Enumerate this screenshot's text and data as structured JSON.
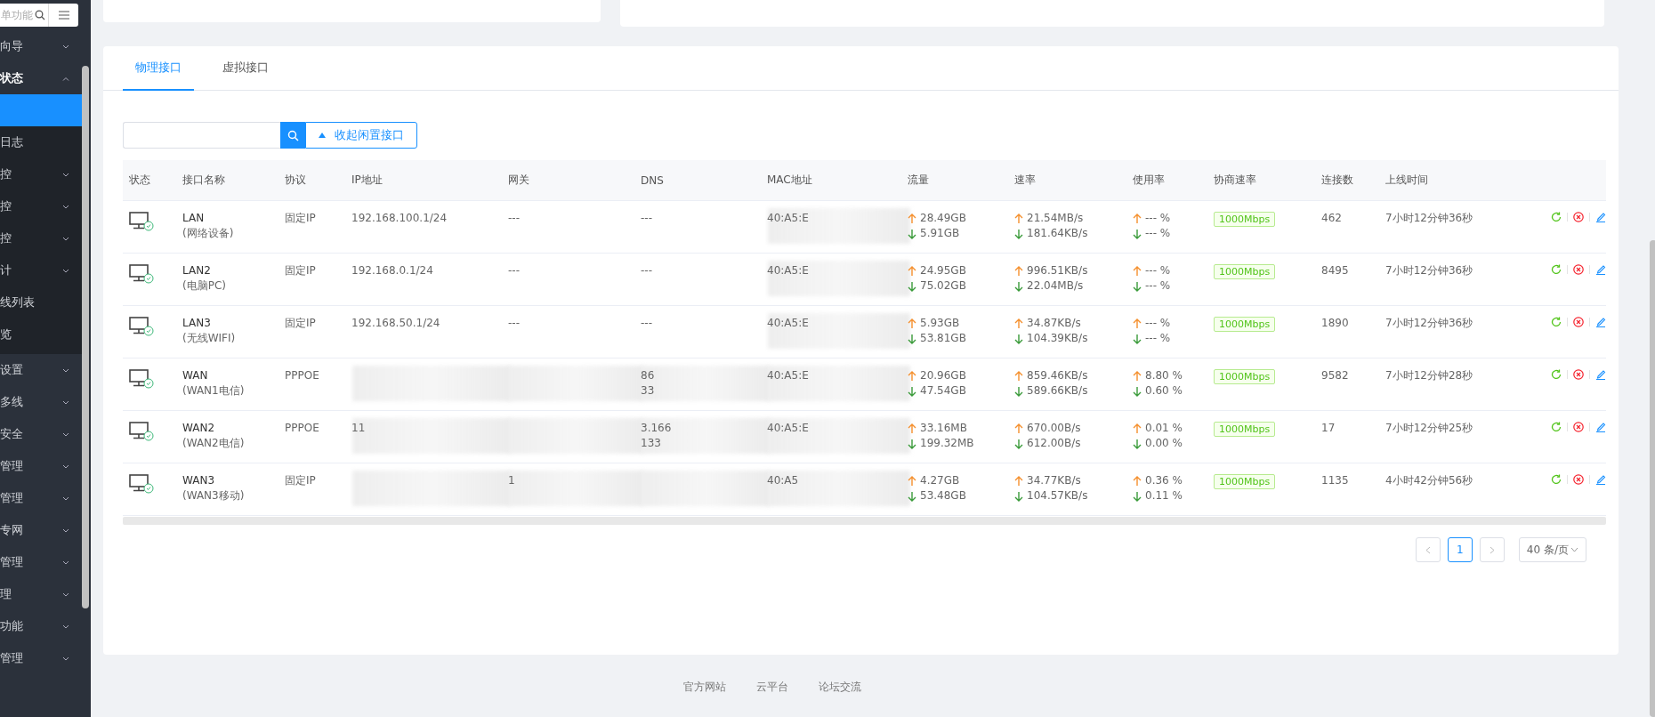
{
  "sidebar": {
    "search_placeholder": "单功能",
    "items": [
      {
        "label": "向导",
        "kind": "group",
        "expanded": false
      },
      {
        "label": "状态",
        "kind": "group",
        "expanded": true,
        "children": [
          {
            "kind": "link",
            "selected": true
          },
          {
            "label": "日志",
            "kind": "link",
            "selected": false
          },
          {
            "label": "控",
            "kind": "group",
            "expanded": false
          },
          {
            "label": "控",
            "kind": "group",
            "expanded": false
          },
          {
            "label": "控",
            "kind": "group",
            "expanded": false
          },
          {
            "label": "计",
            "kind": "group",
            "expanded": false
          },
          {
            "label": "线列表",
            "kind": "link",
            "selected": false
          },
          {
            "label": "览",
            "kind": "link",
            "selected": false
          }
        ]
      },
      {
        "label": "设置",
        "kind": "group",
        "expanded": false
      },
      {
        "label": "多线",
        "kind": "group",
        "expanded": false
      },
      {
        "label": "安全",
        "kind": "group",
        "expanded": false
      },
      {
        "label": "管理",
        "kind": "group",
        "expanded": false
      },
      {
        "label": "管理",
        "kind": "group",
        "expanded": false
      },
      {
        "label": "专网",
        "kind": "group",
        "expanded": false
      },
      {
        "label": "管理",
        "kind": "group",
        "expanded": false
      },
      {
        "label": "理",
        "kind": "group",
        "expanded": false
      },
      {
        "label": "功能",
        "kind": "group",
        "expanded": false
      },
      {
        "label": "管理",
        "kind": "group",
        "expanded": false
      }
    ]
  },
  "tabs": [
    {
      "label": "物理接口",
      "selected": true
    },
    {
      "label": "虚拟接口",
      "selected": false
    }
  ],
  "toolbar": {
    "collapse_button": "收起闲置接口"
  },
  "table": {
    "columns": [
      "状态",
      "接口名称",
      "协议",
      "IP地址",
      "网关",
      "DNS",
      "MAC地址",
      "流量",
      "速率",
      "使用率",
      "协商速率",
      "连接数",
      "上线时间"
    ],
    "rows": [
      {
        "online": true,
        "name": "LAN",
        "note": "(网络设备)",
        "protocol": "固定IP",
        "ip": "192.168.100.1/24",
        "gateway": "---",
        "dns": [
          "---"
        ],
        "mac": "40:A5:E",
        "blur_mac": true,
        "blur_addresses": false,
        "traffic": [
          "28.49GB",
          "5.91GB"
        ],
        "rate": [
          "21.54MB/s",
          "181.64KB/s"
        ],
        "usage": [
          "--- %",
          "--- %"
        ],
        "negotiated": "1000Mbps",
        "connections": "462",
        "uptime": "7小时12分钟36秒"
      },
      {
        "online": true,
        "name": "LAN2",
        "note": "(电脑PC)",
        "protocol": "固定IP",
        "ip": "192.168.0.1/24",
        "gateway": "---",
        "dns": [
          "---"
        ],
        "mac": "40:A5:E",
        "blur_mac": true,
        "blur_addresses": false,
        "traffic": [
          "24.95GB",
          "75.02GB"
        ],
        "rate": [
          "996.51KB/s",
          "22.04MB/s"
        ],
        "usage": [
          "--- %",
          "--- %"
        ],
        "negotiated": "1000Mbps",
        "connections": "8495",
        "uptime": "7小时12分钟36秒"
      },
      {
        "online": true,
        "name": "LAN3",
        "note": "(无线WIFI)",
        "protocol": "固定IP",
        "ip": "192.168.50.1/24",
        "gateway": "---",
        "dns": [
          "---"
        ],
        "mac": "40:A5:E",
        "blur_mac": true,
        "blur_addresses": false,
        "traffic": [
          "5.93GB",
          "53.81GB"
        ],
        "rate": [
          "34.87KB/s",
          "104.39KB/s"
        ],
        "usage": [
          "--- %",
          "--- %"
        ],
        "negotiated": "1000Mbps",
        "connections": "1890",
        "uptime": "7小时12分钟36秒"
      },
      {
        "online": true,
        "name": "WAN",
        "note": "(WAN1电信)",
        "protocol": "PPPOE",
        "dns": [
          "86",
          "33"
        ],
        "mac": "40:A5:E",
        "blur_mac": true,
        "blur_addresses": true,
        "traffic": [
          "20.96GB",
          "47.54GB"
        ],
        "rate": [
          "859.46KB/s",
          "589.66KB/s"
        ],
        "usage": [
          "8.80 %",
          "0.60 %"
        ],
        "negotiated": "1000Mbps",
        "connections": "9582",
        "uptime": "7小时12分钟28秒"
      },
      {
        "online": true,
        "name": "WAN2",
        "note": "(WAN2电信)",
        "protocol": "PPPOE",
        "ip": "11",
        "dns": [
          "3.166",
          "133"
        ],
        "mac": "40:A5:E",
        "blur_mac": true,
        "blur_addresses": true,
        "traffic": [
          "33.16MB",
          "199.32MB"
        ],
        "rate": [
          "670.00B/s",
          "612.00B/s"
        ],
        "usage": [
          "0.01 %",
          "0.00 %"
        ],
        "negotiated": "1000Mbps",
        "connections": "17",
        "uptime": "7小时12分钟25秒"
      },
      {
        "online": true,
        "name": "WAN3",
        "note": "(WAN3移动)",
        "protocol": "固定IP",
        "gateway": "1",
        "mac": "40:A5",
        "blur_mac": true,
        "blur_addresses": true,
        "traffic": [
          "4.27GB",
          "53.48GB"
        ],
        "rate": [
          "34.77KB/s",
          "104.57KB/s"
        ],
        "usage": [
          "0.36 %",
          "0.11 %"
        ],
        "negotiated": "1000Mbps",
        "connections": "1135",
        "uptime": "4小时42分钟56秒"
      }
    ]
  },
  "pagination": {
    "pages": [
      {
        "label": "1",
        "selected": true
      }
    ],
    "page_size": "40 条/页"
  },
  "footer": {
    "links": [
      "官方网站",
      "云平台",
      "论坛交流"
    ]
  }
}
